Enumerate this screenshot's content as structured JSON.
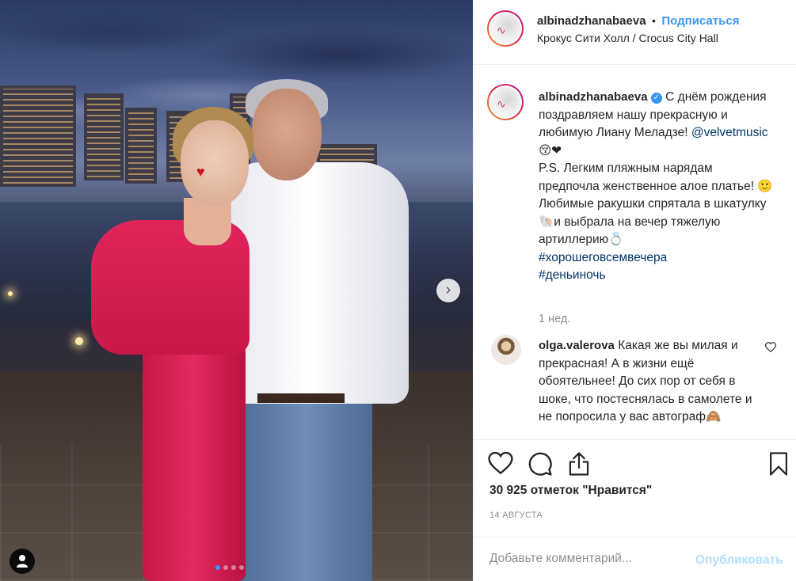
{
  "post": {
    "username": "albinadzhanabaeva",
    "dot_separator": "•",
    "follow_label": "Подписаться",
    "location": "Крокус Сити Холл / Crocus City Hall"
  },
  "caption": {
    "username": "albinadzhanabaeva",
    "verified_mark": "✓",
    "text_1": " С днём рождения поздравляем нашу прекрасную и любимую Лиану Меладзе! ",
    "mention": "@velvetmusic",
    "text_2": " 😚❤",
    "text_3": "P.S. Легким пляжным нарядам предпочла женственное алое платье! 🙂",
    "text_4": "Любимые ракушки спрятала в шкатулку 🐚и выбрала на вечер тяжелую артиллерию💍",
    "hashtag_1": "#хорошеговсемвечера",
    "hashtag_2": "#деньиночь",
    "time": "1 нед."
  },
  "comment": {
    "username": "olga.valerova",
    "text": " Какая же вы милая и прекрасная! А в жизни ещё обоятельнее! До сих пор от себя в шоке, что постеснялась в самолете и не попросила у вас автограф🙈"
  },
  "stats": {
    "likes": "30 925 отметок \"Нравится\"",
    "date": "14 августа"
  },
  "compose": {
    "placeholder": "Добавьте комментарий...",
    "publish_label": "Опубликовать"
  },
  "carousel": {
    "total": 4,
    "active_index": 0
  },
  "icons": {
    "like": "heart-icon",
    "comment": "comment-icon",
    "share": "share-icon",
    "save": "bookmark-icon",
    "next": "chevron-right-icon",
    "tagged_user": "user-icon"
  },
  "colors": {
    "link": "#003569",
    "accent_blue": "#3897f0",
    "publish_disabled": "#b2dffc",
    "muted": "#8e8e8e"
  }
}
